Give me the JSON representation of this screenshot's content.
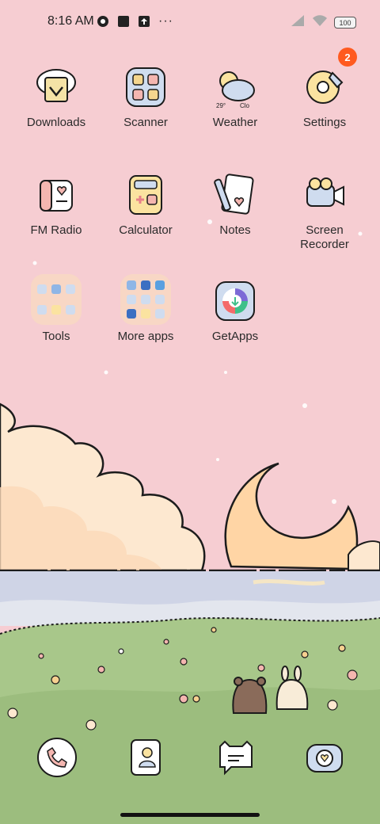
{
  "status_bar": {
    "time": "8:16 AM",
    "icons": [
      "app-c-icon",
      "square-icon",
      "upload-icon"
    ],
    "more": "···",
    "battery": "100"
  },
  "apps": [
    {
      "label": "Downloads",
      "icon": "downloads-icon"
    },
    {
      "label": "Scanner",
      "icon": "scanner-icon"
    },
    {
      "label": "Weather",
      "icon": "weather-icon",
      "extra": [
        "29°",
        "Clo"
      ]
    },
    {
      "label": "Settings",
      "icon": "gear-icon",
      "badge": "2"
    },
    {
      "label": "FM Radio",
      "icon": "radio-icon"
    },
    {
      "label": "Calculator",
      "icon": "calculator-icon"
    },
    {
      "label": "Notes",
      "icon": "notes-icon"
    },
    {
      "label": "Screen\nRecorder",
      "line1": "Screen",
      "line2": "Recorder",
      "icon": "camera-icon"
    },
    {
      "label": "Tools",
      "icon": "folder-icon"
    },
    {
      "label": "More apps",
      "icon": "folder-icon"
    },
    {
      "label": "GetApps",
      "icon": "getapps-icon"
    }
  ],
  "dock": [
    "phone-icon",
    "contacts-icon",
    "messages-icon",
    "camera-icon"
  ],
  "colors": {
    "sky": "#f6cdd2",
    "badge": "#ff5a1f",
    "grass": "#a8c78a"
  }
}
